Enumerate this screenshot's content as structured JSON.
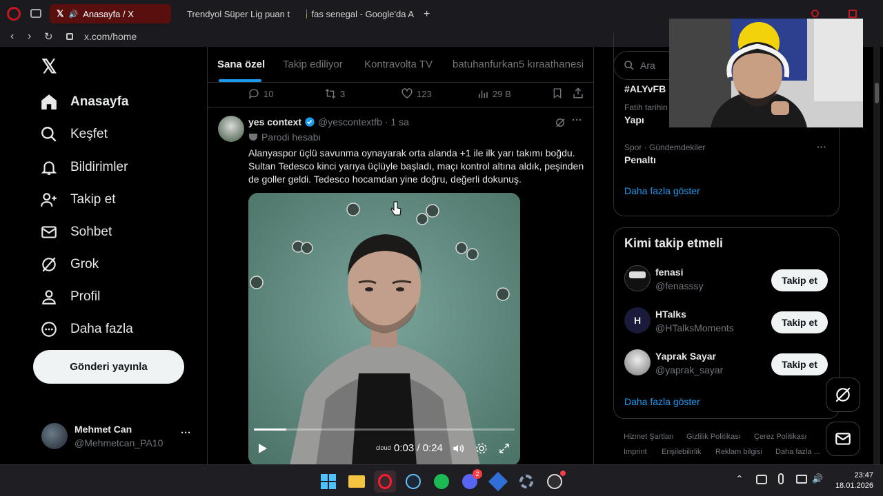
{
  "browser": {
    "tabs": [
      {
        "label": "Anasayfa / X",
        "active": true
      },
      {
        "label": "Trendyol Süper Lig puan t",
        "active": false
      },
      {
        "label": "fas senegal - Google'da A",
        "active": false
      }
    ],
    "url": "x.com/home"
  },
  "sidebar": {
    "items": [
      {
        "label": "Anasayfa"
      },
      {
        "label": "Keşfet"
      },
      {
        "label": "Bildirimler"
      },
      {
        "label": "Takip et"
      },
      {
        "label": "Sohbet"
      },
      {
        "label": "Grok"
      },
      {
        "label": "Profil"
      },
      {
        "label": "Daha fazla"
      }
    ],
    "post_button": "Gönderi yayınla",
    "account": {
      "name": "Mehmet Can",
      "handle": "@Mehmetcan_PA10",
      "more": "···"
    }
  },
  "feed": {
    "tabs": [
      "Sana özel",
      "Takip ediliyor",
      "Kontravolta TV",
      "batuhanfurkan5 kıraathanesi"
    ],
    "prev_actions": {
      "replies": "10",
      "reposts": "3",
      "likes": "123",
      "views": "29 B"
    },
    "tweet": {
      "author": "yes context",
      "handle": "@yescontextfb",
      "time": "· 1 sa",
      "label": "Parodi hesabı",
      "text": "Alanyaspor üçlü savunma oynayarak orta alanda +1 ile ilk yarı takımı boğdu. Sultan Tedesco kinci yarıya üçlüyle başladı, maçı kontrol altına aldık, peşinden de goller geldi. Tedesco hocamdan yine doğru, değerli dokunuş.",
      "video": {
        "time": "0:03 / 0:24",
        "progress": 0.125,
        "watermark": "cloud"
      }
    }
  },
  "right": {
    "search_placeholder": "Ara",
    "trends": [
      {
        "meta": "",
        "name": "#ALYvFB"
      },
      {
        "meta": "Fatih tarihin",
        "name": "Yapı"
      },
      {
        "meta": "Spor · Gündemdekiler",
        "name": "Penaltı"
      }
    ],
    "show_more": "Daha fazla göster",
    "wtf": {
      "title": "Kimi takip etmeli",
      "users": [
        {
          "name": "fenasi",
          "handle": "@fenasssy"
        },
        {
          "name": "HTalks",
          "handle": "@HTalksMoments"
        },
        {
          "name": "Yaprak Sayar",
          "handle": "@yaprak_sayar"
        }
      ],
      "follow_label": "Takip et",
      "show_more": "Daha fazla göster"
    },
    "footer": [
      "Hizmet Şartları",
      "Gizlilik Politikası",
      "Çerez Politikası",
      "Imprint",
      "Erişilebilirlik",
      "Reklam bilgisi",
      "Daha fazla ..."
    ]
  },
  "taskbar": {
    "time": "23:47",
    "date": "18.01.2026",
    "discord_badge": "2"
  },
  "colors": {
    "accent": "#1d9bf0",
    "opera_red": "#c4161c",
    "video_bg": "#5d8a7e"
  }
}
